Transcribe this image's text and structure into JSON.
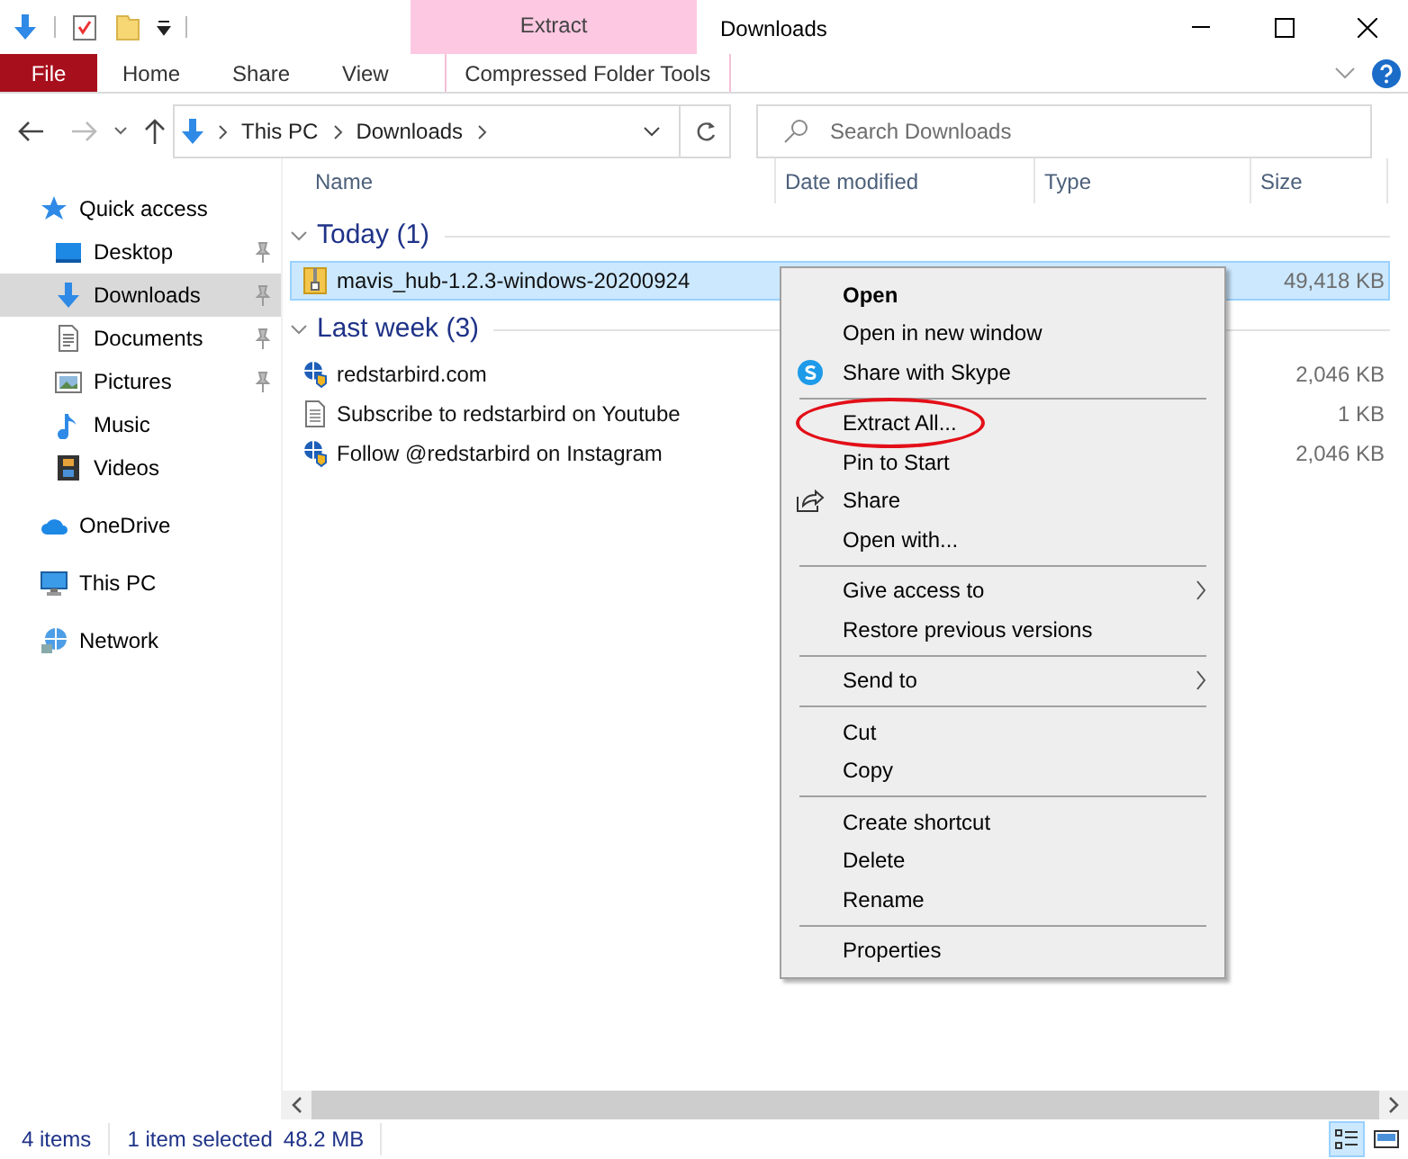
{
  "ribbon": {
    "contextual_tab": {
      "label": "Extract"
    },
    "tabs": [
      {
        "label": "File",
        "kind": "file"
      },
      {
        "label": "Home",
        "kind": "plain"
      },
      {
        "label": "Share",
        "kind": "plain"
      },
      {
        "label": "View",
        "kind": "plain"
      },
      {
        "label": "Compressed Folder Tools",
        "kind": "contextual"
      }
    ]
  },
  "window": {
    "title": "Downloads"
  },
  "address_bar": {
    "path": [
      "This PC",
      "Downloads"
    ]
  },
  "search": {
    "placeholder": "Search Downloads"
  },
  "sidebar": {
    "items": [
      {
        "label": "Quick access",
        "kind": "star",
        "selected": false,
        "children": [
          {
            "label": "Desktop",
            "kind": "desktop",
            "pinned": true,
            "selected": false
          },
          {
            "label": "Downloads",
            "kind": "download",
            "pinned": true,
            "selected": true
          },
          {
            "label": "Documents",
            "kind": "document",
            "pinned": true,
            "selected": false
          },
          {
            "label": "Pictures",
            "kind": "pictures",
            "pinned": true,
            "selected": false
          },
          {
            "label": "Music",
            "kind": "music",
            "pinned": false,
            "selected": false
          },
          {
            "label": "Videos",
            "kind": "videos",
            "pinned": false,
            "selected": false
          }
        ]
      },
      {
        "label": "OneDrive",
        "kind": "cloud",
        "selected": false
      },
      {
        "label": "This PC",
        "kind": "pc",
        "selected": false
      },
      {
        "label": "Network",
        "kind": "network",
        "selected": false
      }
    ]
  },
  "table": {
    "columns": [
      "Name",
      "Date modified",
      "Type",
      "Size"
    ],
    "groups": [
      {
        "label": "Today (1)",
        "expanded": true,
        "files": [
          {
            "name": "mavis_hub-1.2.3-windows-20200924",
            "kind": "zip",
            "size": "49,418 KB",
            "selected": true
          }
        ]
      },
      {
        "label": "Last week (3)",
        "expanded": true,
        "files": [
          {
            "name": "redstarbird.com",
            "kind": "link",
            "size": "2,046 KB",
            "selected": false
          },
          {
            "name": "Subscribe to redstarbird on Youtube",
            "kind": "text",
            "size": "1 KB",
            "selected": false
          },
          {
            "name": "Follow @redstarbird on Instagram",
            "kind": "link",
            "size": "2,046 KB",
            "selected": false
          }
        ]
      }
    ]
  },
  "context_menu": {
    "sections": [
      [
        {
          "label": "Open",
          "default": true
        },
        {
          "label": "Open in new window",
          "default": false
        },
        {
          "label": "Share with Skype",
          "default": false,
          "kind": "skype"
        }
      ],
      [
        {
          "label": "Extract All...",
          "default": false,
          "circled": true
        },
        {
          "label": "Pin to Start",
          "default": false
        },
        {
          "label": "Share",
          "default": false,
          "kind": "share"
        },
        {
          "label": "Open with...",
          "default": false
        }
      ],
      [
        {
          "label": "Give access to",
          "default": false,
          "submenu": true
        },
        {
          "label": "Restore previous versions",
          "default": false
        }
      ],
      [
        {
          "label": "Send to",
          "default": false,
          "submenu": true
        }
      ],
      [
        {
          "label": "Cut",
          "default": false
        },
        {
          "label": "Copy",
          "default": false
        }
      ],
      [
        {
          "label": "Create shortcut",
          "default": false
        },
        {
          "label": "Delete",
          "default": false
        },
        {
          "label": "Rename",
          "default": false
        }
      ],
      [
        {
          "label": "Properties",
          "default": false
        }
      ]
    ]
  },
  "status_bar": {
    "item_count": "4 items",
    "selection": "1 item selected",
    "selection_size": "48.2 MB",
    "views": [
      {
        "kind": "details",
        "selected": true
      },
      {
        "kind": "large",
        "selected": false
      }
    ]
  }
}
